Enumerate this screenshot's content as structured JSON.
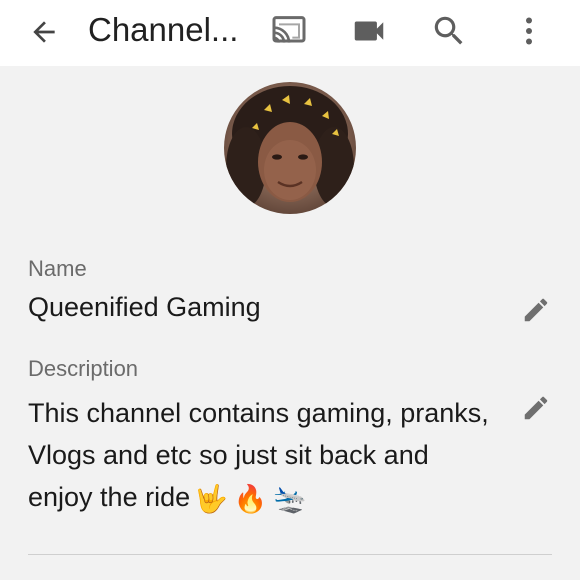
{
  "appbar": {
    "title": "Channel...",
    "back_icon": "arrow-left-icon",
    "cast_icon": "cast-icon",
    "camera_icon": "videocam-icon",
    "search_icon": "search-icon",
    "more_icon": "more-vert-icon"
  },
  "profile": {
    "avatar_icon": "avatar"
  },
  "fields": {
    "name": {
      "label": "Name",
      "value": "Queenified Gaming"
    },
    "description": {
      "label": "Description",
      "value": "This channel contains gaming, pranks, Vlogs and etc so just sit back and enjoy the ride",
      "emojis": [
        "🤟",
        "🔥",
        "🛬"
      ]
    }
  },
  "colors": {
    "appbar_bg": "#ffffff",
    "page_bg": "#f2f2f2",
    "label_text": "#6b6b6b",
    "value_text": "#1a1a1a",
    "icon_gray": "#616161"
  }
}
